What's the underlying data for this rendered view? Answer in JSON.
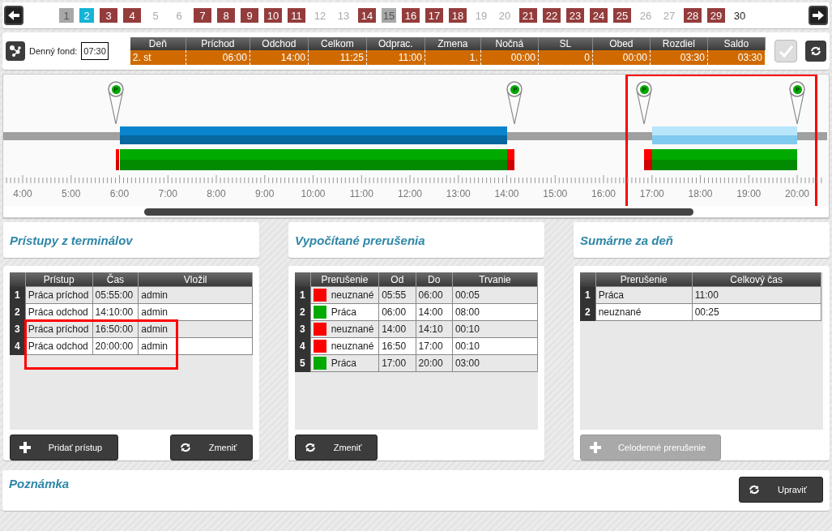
{
  "days": [
    {
      "label": "1",
      "kind": "neutral",
      "selected": false
    },
    {
      "label": "2",
      "kind": "neutral",
      "selected": true
    },
    {
      "label": "3",
      "kind": "absence",
      "selected": false
    },
    {
      "label": "4",
      "kind": "absence",
      "selected": false
    },
    {
      "label": "5",
      "kind": "weekend",
      "selected": false
    },
    {
      "label": "6",
      "kind": "weekend",
      "selected": false
    },
    {
      "label": "7",
      "kind": "absence",
      "selected": false
    },
    {
      "label": "8",
      "kind": "absence",
      "selected": false
    },
    {
      "label": "9",
      "kind": "absence",
      "selected": false
    },
    {
      "label": "10",
      "kind": "absence",
      "selected": false
    },
    {
      "label": "11",
      "kind": "absence",
      "selected": false
    },
    {
      "label": "12",
      "kind": "weekend",
      "selected": false
    },
    {
      "label": "13",
      "kind": "weekend",
      "selected": false
    },
    {
      "label": "14",
      "kind": "absence",
      "selected": false
    },
    {
      "label": "15",
      "kind": "neutral",
      "selected": false
    },
    {
      "label": "16",
      "kind": "absence",
      "selected": false
    },
    {
      "label": "17",
      "kind": "absence",
      "selected": false
    },
    {
      "label": "18",
      "kind": "absence",
      "selected": false
    },
    {
      "label": "19",
      "kind": "weekend",
      "selected": false
    },
    {
      "label": "20",
      "kind": "weekend",
      "selected": false
    },
    {
      "label": "21",
      "kind": "absence",
      "selected": false
    },
    {
      "label": "22",
      "kind": "absence",
      "selected": false
    },
    {
      "label": "23",
      "kind": "absence",
      "selected": false
    },
    {
      "label": "24",
      "kind": "absence",
      "selected": false
    },
    {
      "label": "25",
      "kind": "absence",
      "selected": false
    },
    {
      "label": "26",
      "kind": "weekend",
      "selected": false
    },
    {
      "label": "27",
      "kind": "weekend",
      "selected": false
    },
    {
      "label": "28",
      "kind": "absence",
      "selected": false
    },
    {
      "label": "29",
      "kind": "absence",
      "selected": false
    },
    {
      "label": "30",
      "kind": "plain",
      "selected": false
    }
  ],
  "daily_fund": {
    "label": "Denný fond:",
    "value": "07:30"
  },
  "summary": {
    "columns": [
      "Deň",
      "Príchod",
      "Odchod",
      "Celkom",
      "Odprac.",
      "Zmena",
      "Nočná",
      "SL",
      "Obed",
      "Rozdiel",
      "Saldo"
    ],
    "row": [
      "2. st",
      "06:00",
      "14:00",
      "11:25",
      "11:00",
      "1.",
      "00:00",
      "0",
      "00:00",
      "03:30",
      "03:30"
    ],
    "confirm_disabled": true
  },
  "timeline": {
    "hours": [
      "4:00",
      "5:00",
      "6:00",
      "7:00",
      "8:00",
      "9:00",
      "10:00",
      "11:00",
      "12:00",
      "13:00",
      "14:00",
      "15:00",
      "16:00",
      "17:00",
      "18:00",
      "19:00",
      "20:00"
    ],
    "pins": [
      {
        "label": "P"
      },
      {
        "label": "P"
      },
      {
        "label": "P"
      },
      {
        "label": "P"
      }
    ],
    "sessions": [
      {
        "selected": false
      },
      {
        "selected": true
      }
    ]
  },
  "panels": [
    {
      "title": "Prístupy z terminálov",
      "table": {
        "columns": [
          "Prístup",
          "Čas",
          "Vložil"
        ],
        "rows": [
          {
            "number": "1",
            "cells": [
              "Práca príchod",
              "05:55:00",
              "admin"
            ],
            "highlighted": false
          },
          {
            "number": "2",
            "cells": [
              "Práca odchod",
              "14:10:00",
              "admin"
            ],
            "highlighted": false
          },
          {
            "number": "3",
            "cells": [
              "Práca príchod",
              "16:50:00",
              "admin"
            ],
            "highlighted": true
          },
          {
            "number": "4",
            "cells": [
              "Práca odchod",
              "20:00:00",
              "admin"
            ],
            "highlighted": true
          }
        ]
      },
      "buttons": [
        {
          "label": "Pridať prístup",
          "kind": "add",
          "disabled": false
        },
        {
          "label": "Zmeniť",
          "kind": "change",
          "disabled": false
        }
      ]
    },
    {
      "title": "Vypočítané prerušenia",
      "table": {
        "columns": [
          "Prerušenie",
          "Od",
          "Do",
          "Trvanie"
        ],
        "rows": [
          {
            "number": "1",
            "cells": [
              "neuznané",
              "05:55",
              "06:00",
              "00:05"
            ],
            "color": "#ff0000",
            "kind": "break"
          },
          {
            "number": "2",
            "cells": [
              "Práca",
              "06:00",
              "14:00",
              "08:00"
            ],
            "color": "#00aa00",
            "kind": "work"
          },
          {
            "number": "3",
            "cells": [
              "neuznané",
              "14:00",
              "14:10",
              "00:10"
            ],
            "color": "#ff0000",
            "kind": "break"
          },
          {
            "number": "4",
            "cells": [
              "neuznané",
              "16:50",
              "17:00",
              "00:10"
            ],
            "color": "#ff0000",
            "kind": "break"
          },
          {
            "number": "5",
            "cells": [
              "Práca",
              "17:00",
              "20:00",
              "03:00"
            ],
            "color": "#00aa00",
            "kind": "work"
          }
        ]
      },
      "buttons": [
        {
          "label": "Zmeniť",
          "kind": "change",
          "disabled": false
        }
      ]
    },
    {
      "title": "Sumárne za deň",
      "table": {
        "columns": [
          "Prerušenie",
          "Celkový čas"
        ],
        "rows": [
          {
            "number": "1",
            "cells": [
              "Práca",
              "11:00"
            ]
          },
          {
            "number": "2",
            "cells": [
              "neuznané",
              "00:25"
            ]
          }
        ]
      },
      "buttons": [
        {
          "label": "Celodenné prerušenie",
          "kind": "add",
          "disabled": true
        }
      ]
    }
  ],
  "note": {
    "title": "Poznámka",
    "button": {
      "label": "Upraviť",
      "kind": "change",
      "disabled": false
    }
  }
}
